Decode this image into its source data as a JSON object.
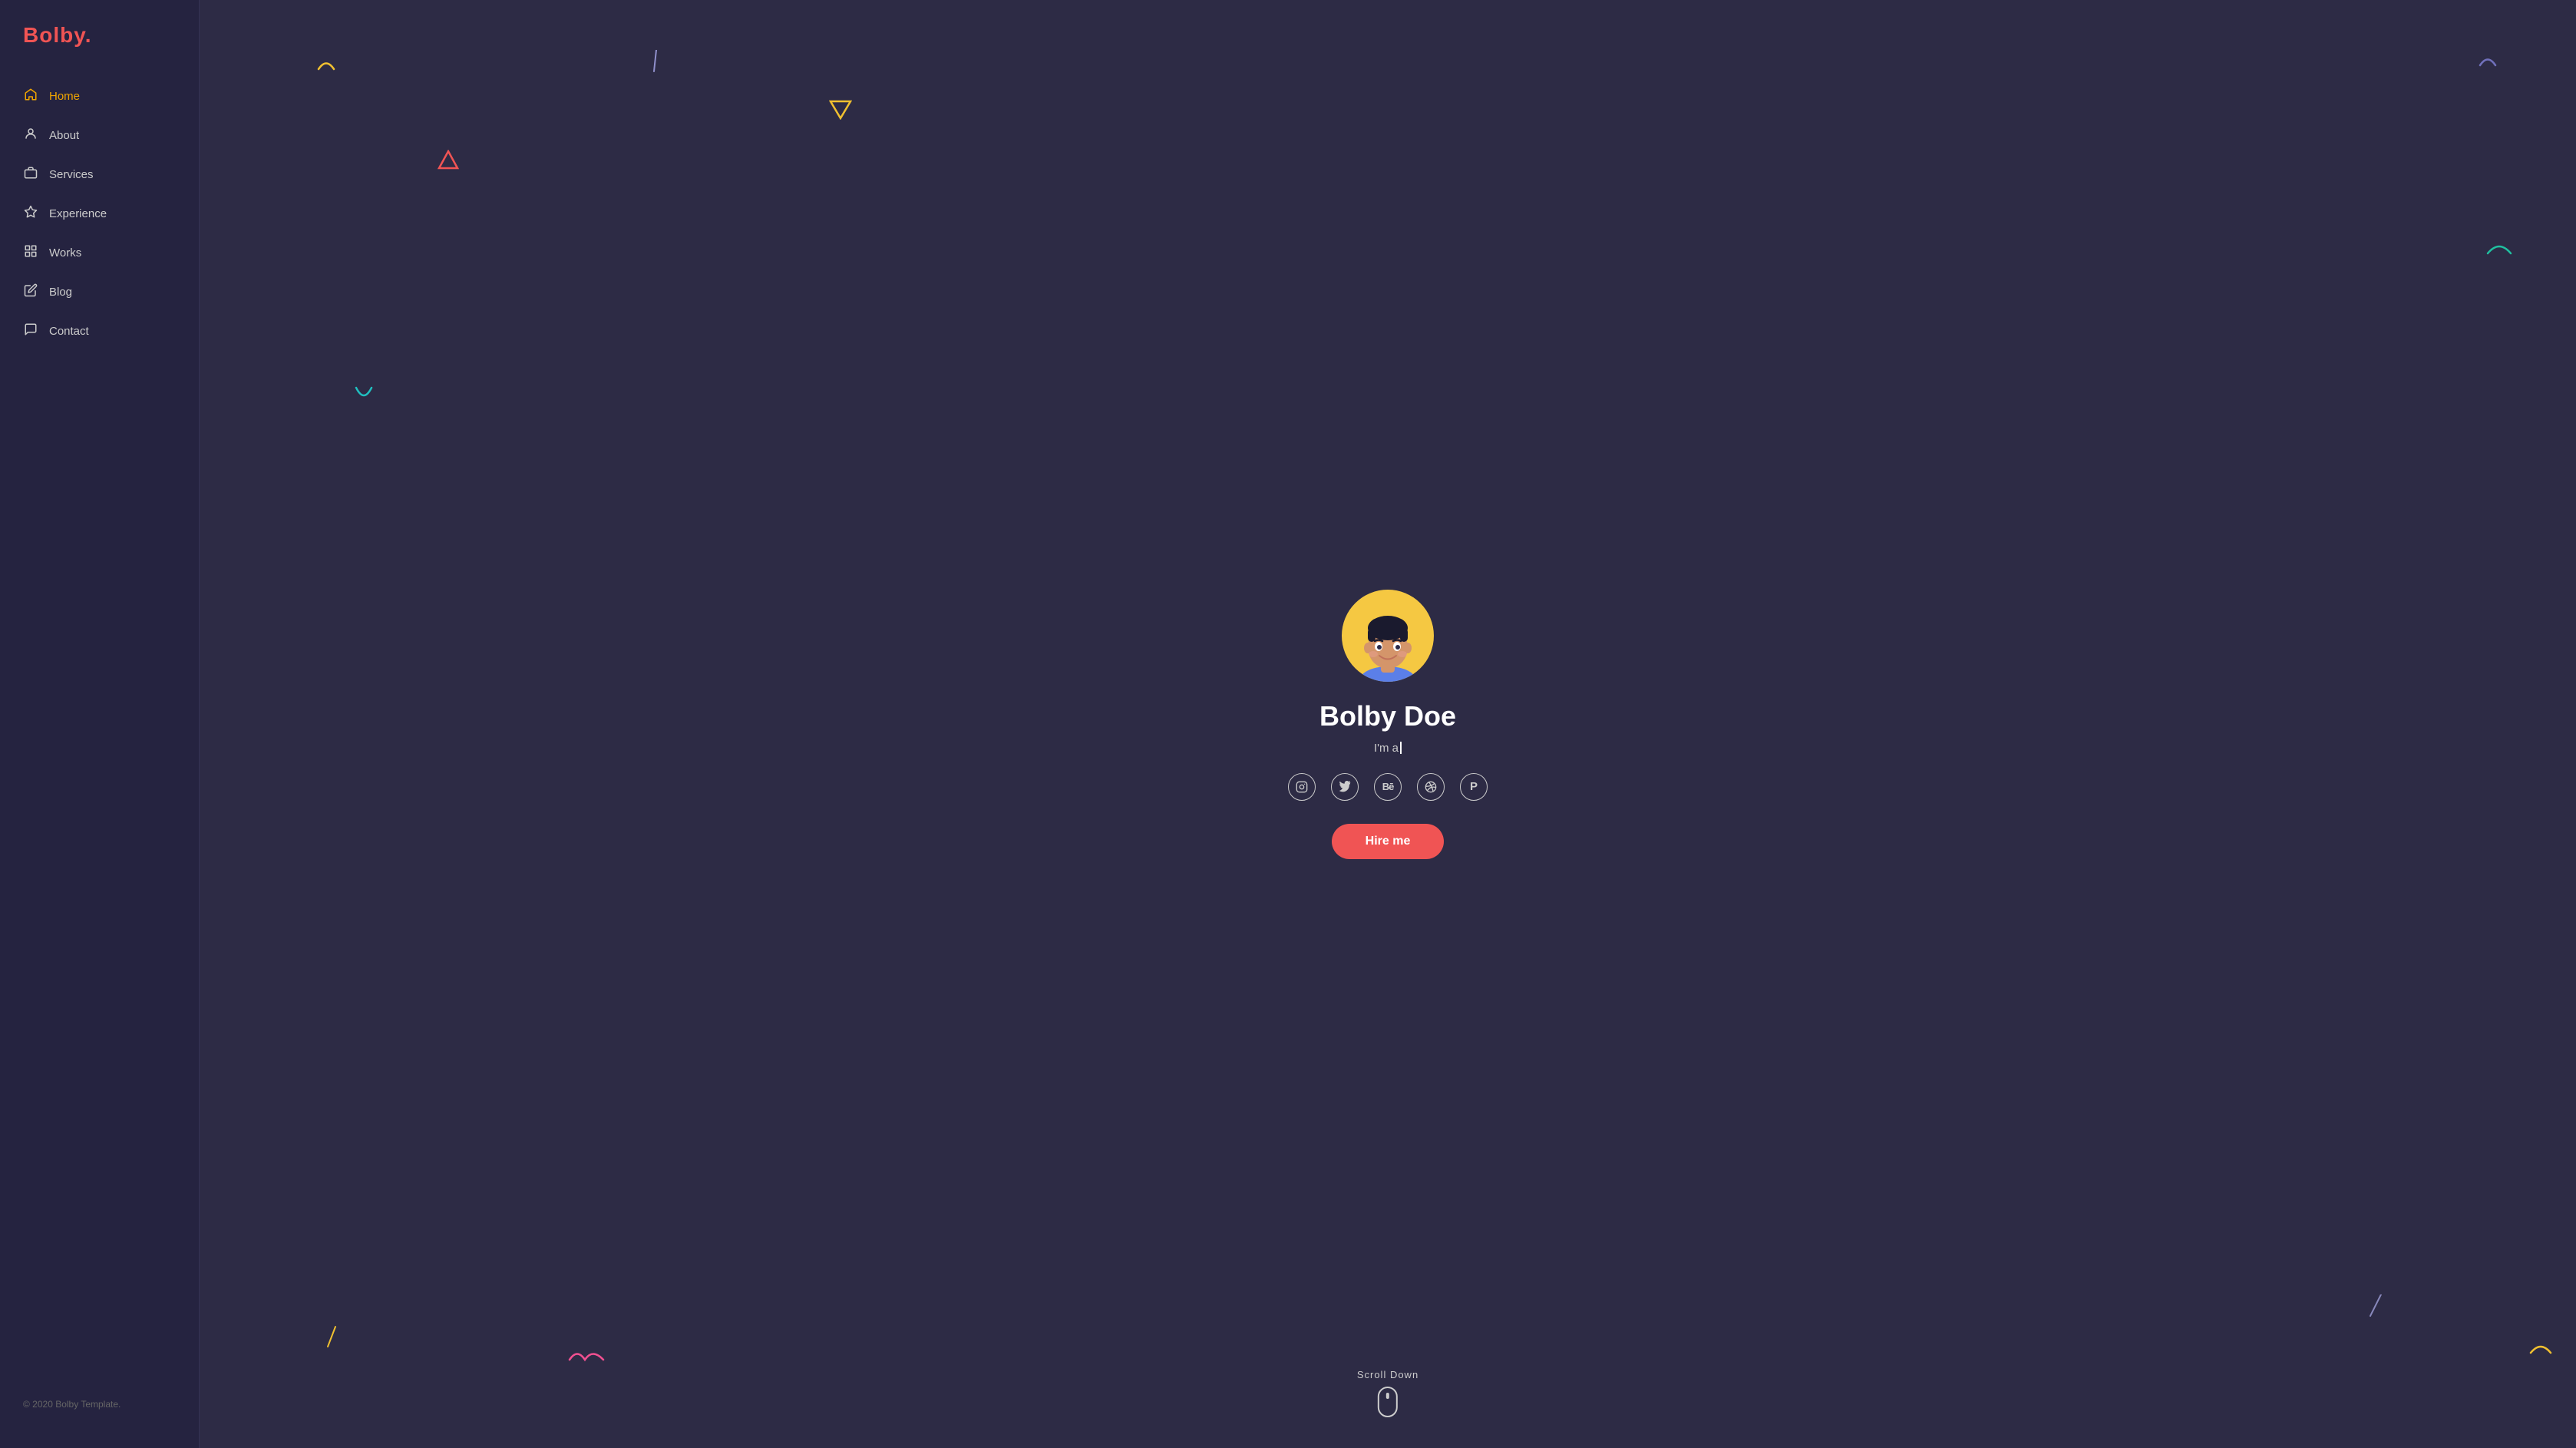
{
  "logo": {
    "text": "Bolby",
    "dot": "."
  },
  "nav": {
    "items": [
      {
        "id": "home",
        "label": "Home",
        "icon": "🏠",
        "active": true
      },
      {
        "id": "about",
        "label": "About",
        "icon": "👤",
        "active": false
      },
      {
        "id": "services",
        "label": "Services",
        "icon": "💼",
        "active": false
      },
      {
        "id": "experience",
        "label": "Experience",
        "icon": "🎓",
        "active": false
      },
      {
        "id": "works",
        "label": "Works",
        "icon": "📚",
        "active": false
      },
      {
        "id": "blog",
        "label": "Blog",
        "icon": "✏️",
        "active": false
      },
      {
        "id": "contact",
        "label": "Contact",
        "icon": "💬",
        "active": false
      }
    ]
  },
  "footer": {
    "copyright": "© 2020 Bolby Template."
  },
  "hero": {
    "name": "Bolby Doe",
    "subtitle_prefix": "I'm a ",
    "hire_label": "Hire me"
  },
  "scroll_down": {
    "label": "Scroll Down"
  },
  "social": [
    {
      "id": "instagram",
      "symbol": "📷"
    },
    {
      "id": "twitter",
      "symbol": "🐦"
    },
    {
      "id": "behance",
      "symbol": "Bē"
    },
    {
      "id": "dribbble",
      "symbol": "🏀"
    },
    {
      "id": "pinterest",
      "symbol": "P"
    }
  ],
  "colors": {
    "bg": "#2d2b45",
    "sidebar": "#252340",
    "accent_orange": "#f0a500",
    "accent_red": "#f05454",
    "avatar_bg": "#f5c842"
  }
}
